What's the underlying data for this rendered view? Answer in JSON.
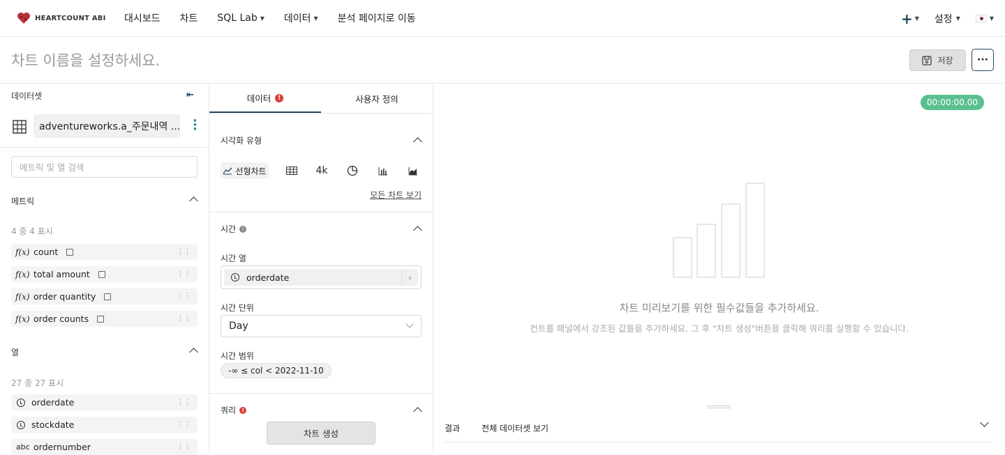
{
  "nav": {
    "logo_text": "HEARTCOUNT ABI",
    "items": [
      {
        "label": "대시보드",
        "dropdown": false
      },
      {
        "label": "차트",
        "dropdown": false
      },
      {
        "label": "SQL Lab",
        "dropdown": true
      },
      {
        "label": "데이터",
        "dropdown": true
      },
      {
        "label": "분석 페이지로 이동",
        "dropdown": false
      }
    ],
    "plus_icon": "plus-icon",
    "settings_label": "설정",
    "language_flag": "korea-flag-icon",
    "accent": "#1f4a5e"
  },
  "titlebar": {
    "chart_name_placeholder": "차트 이름을 설정하세요.",
    "save_label": "저장",
    "more_label": "···"
  },
  "dataset_panel": {
    "header": "데이터셋",
    "dataset_name": "adventureworks.a_주문내역 ...",
    "search_placeholder": "메트릭 및 열 검색",
    "metrics_header": "메트릭",
    "metrics_count": "4 중 4 표시",
    "metrics": [
      {
        "fx": "f(x)",
        "label": "count"
      },
      {
        "fx": "f(x)",
        "label": "total amount"
      },
      {
        "fx": "f(x)",
        "label": "order quantity"
      },
      {
        "fx": "f(x)",
        "label": "order counts"
      }
    ],
    "columns_header": "열",
    "columns_count": "27 중 27 표시",
    "columns": [
      {
        "type": "clock-icon",
        "label": "orderdate"
      },
      {
        "type": "clock-icon",
        "label": "stockdate"
      },
      {
        "type_text": "abc",
        "label": "ordernumber"
      }
    ]
  },
  "control_panel": {
    "tabs": [
      {
        "label": "데이터",
        "active": true,
        "alert": "!"
      },
      {
        "label": "사용자 정의",
        "active": false
      }
    ],
    "viz_type_label": "시각화 유형",
    "viz_types": [
      {
        "icon": "line-chart-icon",
        "label": "선형차트",
        "selected": true
      },
      {
        "icon": "table-icon"
      },
      {
        "label": "4k",
        "icon": "big-number"
      },
      {
        "icon": "pie-chart-icon"
      },
      {
        "icon": "bar-chart-icon"
      },
      {
        "icon": "area-chart-icon"
      }
    ],
    "view_all_charts": "모든 차트 보기",
    "time_section": "시간",
    "time_column_label": "시간 열",
    "time_column_value": "orderdate",
    "time_grain_label": "시간 단위",
    "time_grain_value": "Day",
    "time_range_label": "시간 범위",
    "time_range_value": "-∞ ≤ col < 2022-11-10",
    "query_section": "쿼리",
    "create_chart_button": "차트 생성"
  },
  "preview": {
    "timer": "00:00:00.00",
    "timer_color": "#5ac08f",
    "empty_title": "차트 미리보기를 위한 필수값들을 추가하세요.",
    "empty_subtitle": "컨트롤 패널에서 강조된 값들을 추가하세요. 그 후 \"차트 생성\"버튼을 클릭해 쿼리를 실행할 수 있습니다.",
    "results_label": "결과",
    "full_dataset_label": "전체 데이터셋 보기"
  }
}
